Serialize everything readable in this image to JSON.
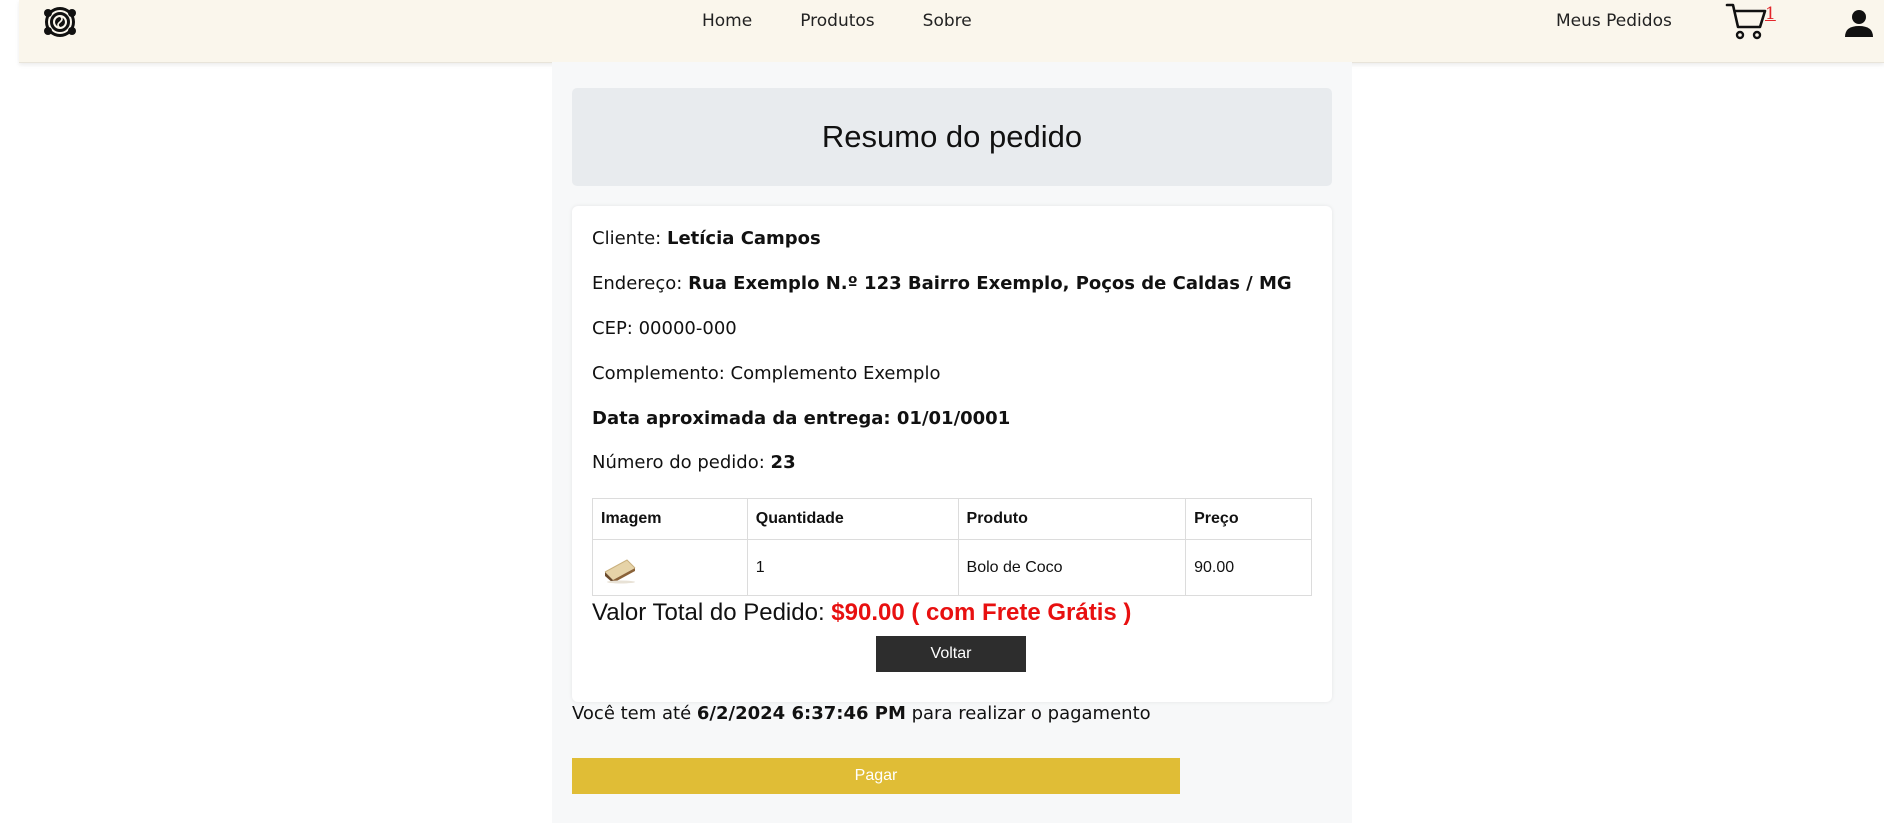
{
  "nav": {
    "links": [
      "Home",
      "Produtos",
      "Sobre"
    ],
    "meus_pedidos": "Meus Pedidos",
    "cart_count": "1",
    "logo_icon": "rose-logo-icon",
    "cart_icon": "cart-icon",
    "user_icon": "user-icon"
  },
  "summary": {
    "title": "Resumo do pedido",
    "client_label": "Cliente:",
    "client_name": "Letícia Campos",
    "address_label": "Endereço:",
    "address": "Rua Exemplo N.º 123 Bairro Exemplo, Poços de Caldas / MG",
    "cep_label": "CEP:",
    "cep": "00000-000",
    "complement_label": "Complemento:",
    "complement": "Complemento Exemplo",
    "delivery_label": "Data aproximada da entrega:",
    "delivery_date": "01/01/0001",
    "order_number_label": "Número do pedido:",
    "order_number": "23"
  },
  "table": {
    "headers": [
      "Imagem",
      "Quantidade",
      "Produto",
      "Preço"
    ],
    "rows": [
      {
        "quantity": "1",
        "product": "Bolo de Coco",
        "price": "90.00"
      }
    ]
  },
  "total": {
    "label": "Valor Total do Pedido:",
    "value": "$90.00 ( com Frete Grátis )"
  },
  "buttons": {
    "voltar": "Voltar",
    "pagar": "Pagar"
  },
  "payment": {
    "prefix": "Você tem até",
    "deadline": "6/2/2024 6:37:46 PM",
    "suffix": "para realizar o pagamento"
  },
  "colors": {
    "navbar_bg": "#faf6ec",
    "total_red": "#e81010",
    "pagar_yellow": "#e0bd36",
    "voltar_dark": "#2d2d2d",
    "cart_count_red": "#e3262a"
  }
}
